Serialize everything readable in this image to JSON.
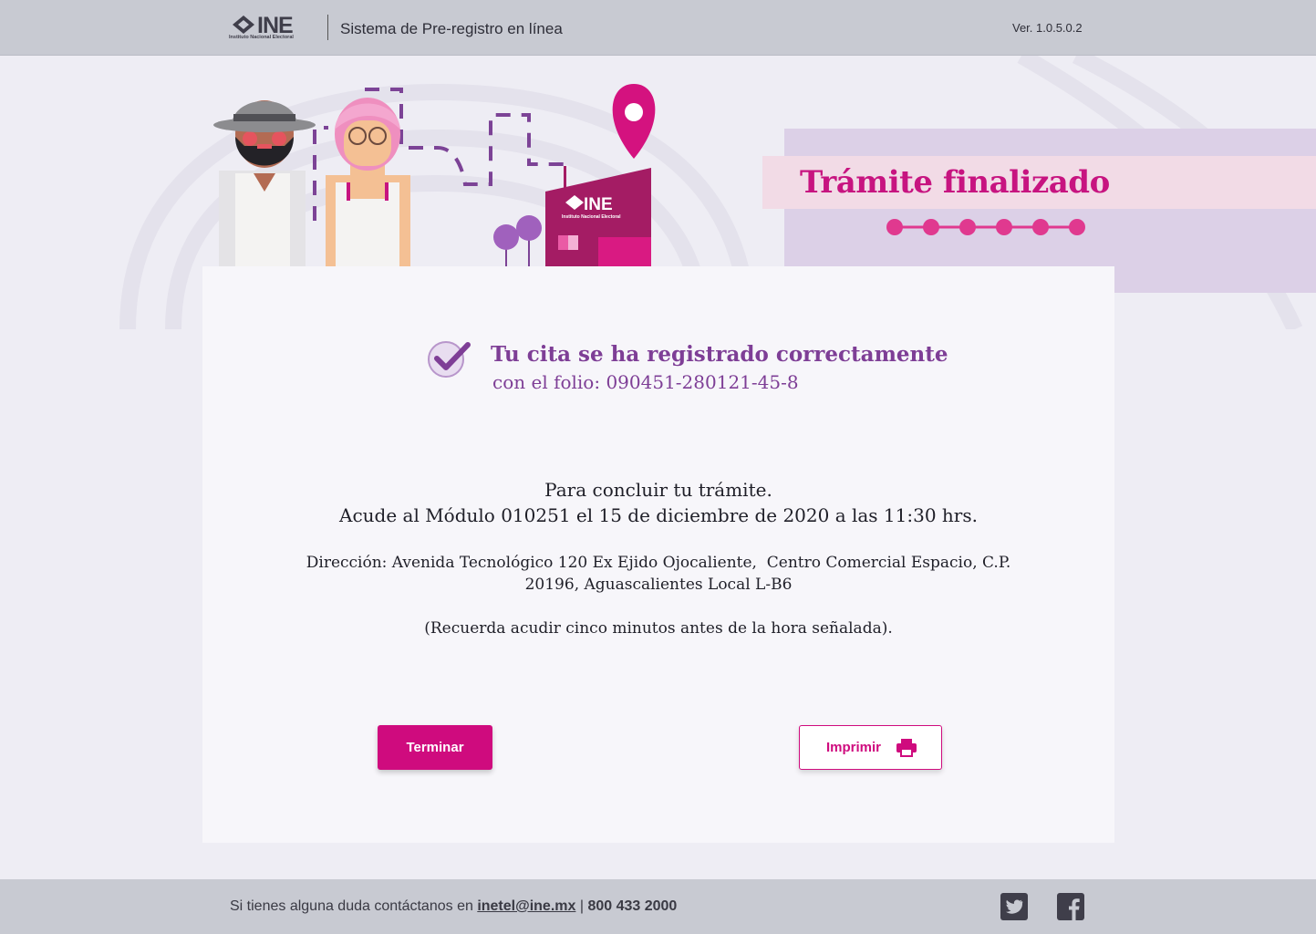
{
  "header": {
    "logo_text": "INE",
    "logo_subtitle": "Instituto Nacional Electoral",
    "app_title": "Sistema de Pre-registro en línea",
    "version": "Ver. 1.0.5.0.2"
  },
  "hero": {
    "status_title": "Trámite finalizado",
    "building_logo_text": "INE",
    "building_logo_subtitle": "Instituto Nacional Electoral",
    "steps_completed": 6,
    "steps_total": 6
  },
  "confirmation": {
    "title": "Tu cita se ha registrado correctamente",
    "folio": "con el folio: 090451-280121-45-8"
  },
  "instructions": {
    "line1": "Para concluir tu trámite.",
    "line2": "Acude al Módulo 010251 el 15 de diciembre de 2020 a las 11:30 hrs.",
    "address_line1": "Dirección: Avenida Tecnológico 120 Ex Ejido Ojocaliente,  Centro Comercial Espacio, C.P.",
    "address_line2": "20196, Aguascalientes Local L-B6",
    "reminder": "(Recuerda acudir cinco minutos antes de la hora señalada)."
  },
  "actions": {
    "finish_label": "Terminar",
    "print_label": "Imprimir"
  },
  "footer": {
    "contact_text": "Si tienes alguna duda contáctanos en ",
    "email": "inetel@ine.mx",
    "separator": " | ",
    "phone": "800 433 2000"
  },
  "colors": {
    "brand_magenta": "#cf0b7e",
    "accent_purple": "#7e3e96",
    "bar_gray": "#c8cad2"
  },
  "icons": [
    "ine-logo-icon",
    "check-icon",
    "printer-icon",
    "twitter-icon",
    "facebook-icon",
    "location-pin-icon"
  ]
}
